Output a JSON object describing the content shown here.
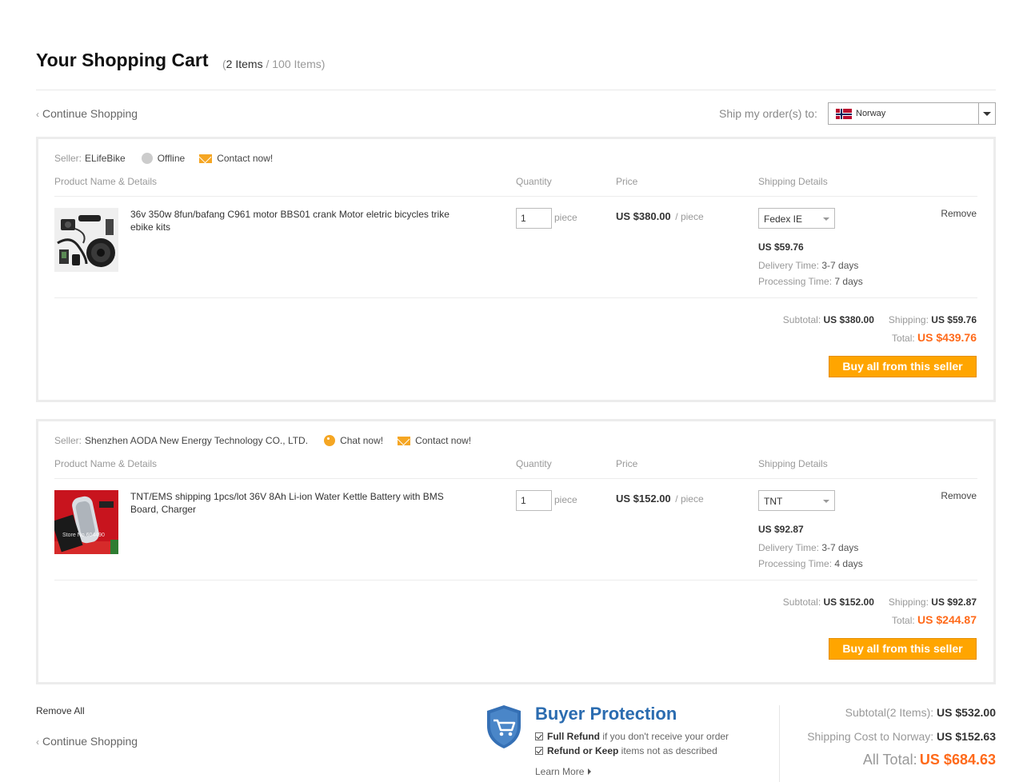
{
  "header": {
    "title": "Your Shopping Cart",
    "count_open": "(",
    "count_current": "2 Items",
    "count_sep": " / ",
    "count_max": "100 Items",
    "count_close": ")"
  },
  "nav": {
    "continue_shopping": "Continue Shopping",
    "chevron": "‹"
  },
  "shipping_destination": {
    "label": "Ship my order(s) to:",
    "country": "Norway",
    "flag_icon": "norway-flag-icon"
  },
  "table_headers": {
    "product": "Product Name & Details",
    "quantity": "Quantity",
    "price": "Price",
    "shipping": "Shipping Details"
  },
  "sellers": [
    {
      "seller_label": "Seller:",
      "seller_name": "ELifeBike",
      "status_label": "Offline",
      "status_icon": "offline-status-icon",
      "contact_label": "Contact now!",
      "item": {
        "name": "36v 350w 8fun/bafang C961 motor BBS01 crank Motor eletric bicycles trike ebike kits",
        "quantity": "1",
        "unit": "piece",
        "price": "US $380.00",
        "per": "/ piece",
        "shipping_method": "Fedex IE",
        "shipping_cost": "US $59.76",
        "delivery_label": "Delivery Time:",
        "delivery_value": "3-7 days",
        "processing_label": "Processing Time:",
        "processing_value": "7 days",
        "remove_label": "Remove"
      },
      "summary": {
        "subtotal_label": "Subtotal:",
        "subtotal_value": "US $380.00",
        "shipping_label": "Shipping:",
        "shipping_value": "US $59.76",
        "total_label": "Total:",
        "total_value": "US $439.76"
      },
      "buy_button": "Buy all from this seller"
    },
    {
      "seller_label": "Seller:",
      "seller_name": "Shenzhen AODA New Energy Technology CO., LTD.",
      "status_label": "Chat now!",
      "status_icon": "chat-status-icon",
      "contact_label": "Contact now!",
      "item": {
        "name": "TNT/EMS shipping 1pcs/lot 36V 8Ah Li-ion Water Kettle Battery with BMS Board, Charger",
        "quantity": "1",
        "unit": "piece",
        "price": "US $152.00",
        "per": "/ piece",
        "shipping_method": "TNT",
        "shipping_cost": "US $92.87",
        "delivery_label": "Delivery Time:",
        "delivery_value": "3-7 days",
        "processing_label": "Processing Time:",
        "processing_value": "4 days",
        "remove_label": "Remove",
        "image_watermark": "Store No.604490"
      },
      "summary": {
        "subtotal_label": "Subtotal:",
        "subtotal_value": "US $152.00",
        "shipping_label": "Shipping:",
        "shipping_value": "US $92.87",
        "total_label": "Total:",
        "total_value": "US $244.87"
      },
      "buy_button": "Buy all from this seller"
    }
  ],
  "footer": {
    "remove_all": "Remove All",
    "buyer_protection": {
      "title": "Buyer Protection",
      "line1_bold": "Full Refund",
      "line1_rest": " if you don't receive your order",
      "line2_bold": "Refund or Keep",
      "line2_rest": " items not as described",
      "learn_more": "Learn More"
    },
    "totals": {
      "subtotal_label": "Subtotal(2 Items):",
      "subtotal_value": "US $532.00",
      "shipping_label": "Shipping Cost to Norway:",
      "shipping_value": "US $152.63",
      "all_total_label": "All Total:",
      "all_total_value": "US $684.63"
    }
  },
  "colors": {
    "accent_orange": "#ff6a1a",
    "button_orange": "#ffa500",
    "protection_blue": "#2b6cb0"
  }
}
